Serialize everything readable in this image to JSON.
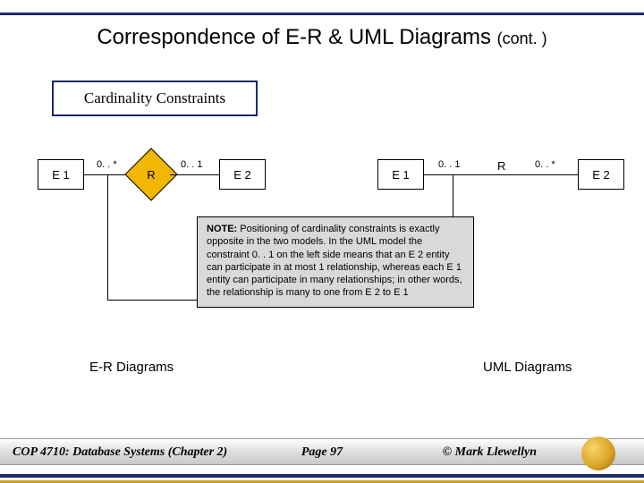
{
  "title_main": "Correspondence of E-R & UML Diagrams",
  "title_cont": "(cont. )",
  "card_constraints": "Cardinality Constraints",
  "er": {
    "e1": "E 1",
    "e2": "E 2",
    "r": "R",
    "c_left": "0. . *",
    "c_right": "0. . 1"
  },
  "uml": {
    "e1": "E 1",
    "e2": "E 2",
    "r": "R",
    "c_left": "0. . 1",
    "c_right": "0. . *"
  },
  "note_label": "NOTE:",
  "note_body": "Positioning of cardinality constraints is exactly opposite in the two models. In the UML model the constraint 0. . 1 on the left side means that an E 2 entity can participate in at most 1 relationship, whereas each E 1 entity can participate in many relationships; in other words, the relationship is many to one from E 2 to E 1",
  "section_er": "E-R Diagrams",
  "section_uml": "UML Diagrams",
  "course": "COP 4710: Database Systems  (Chapter 2)",
  "page": "Page 97",
  "copyright": "© Mark Llewellyn"
}
